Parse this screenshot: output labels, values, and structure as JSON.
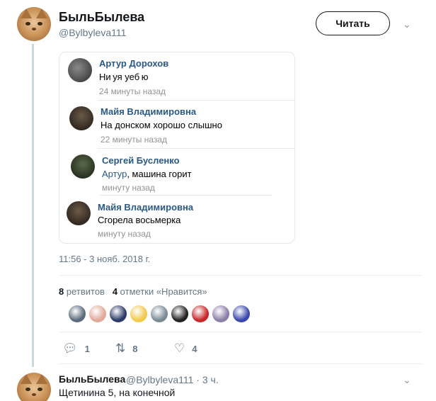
{
  "tweet": {
    "author_name": "БыльБылева",
    "author_handle": "@Bylbyleva111",
    "follow_label": "Читать",
    "menu_icon": "chevron-down-icon",
    "timestamp": "11:56 - 3 нояб. 2018 г.",
    "retweets_count": "8",
    "retweets_label": "ретвитов",
    "likes_count": "4",
    "likes_label": "отметки «Нравится»",
    "actions": {
      "replies": "1",
      "retweets": "8",
      "likes": "4"
    }
  },
  "screenshot_comments": [
    {
      "name": "Артур Дорохов",
      "text": "Ни уя уеб ю",
      "time": "24 минуты назад"
    },
    {
      "name": "Майя Владимировна",
      "text": "На донском хорошо слышно",
      "time": "22 минуты назад"
    },
    {
      "name": "Сергей Бусленко",
      "mention": "Артур",
      "text": ", машина горит",
      "time": "минуту назад"
    },
    {
      "name": "Майя Владимировна",
      "text": "Сгорела восьмерка",
      "time": "минуту назад"
    }
  ],
  "liker_colors": [
    "#5a6b7c",
    "#e0a99a",
    "#2b3a67",
    "#f2c94c",
    "#7a8a94",
    "#222222",
    "#c62828",
    "#8b7fa6",
    "#3949ab"
  ],
  "reply": {
    "author_name": "БыльБылева",
    "author_handle": "@Bylbyleva111",
    "time": "· 3 ч.",
    "text": "Щетинина 5, на конечной"
  }
}
